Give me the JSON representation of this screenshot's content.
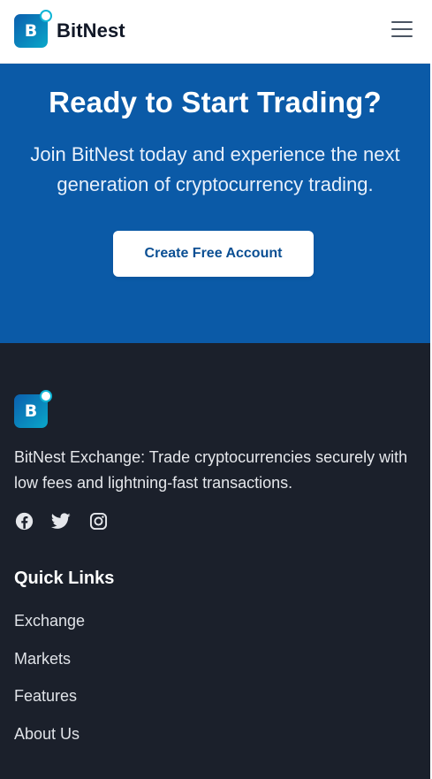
{
  "header": {
    "brand_name": "BitNest",
    "logo_letter": "B",
    "menu_icon": "hamburger-menu-icon"
  },
  "hero": {
    "title": "Ready to Start Trading?",
    "subtitle": "Join BitNest today and experience the next generation of cryptocurrency trading.",
    "cta_label": "Create Free Account"
  },
  "footer": {
    "logo_letter": "B",
    "description": "BitNest Exchange: Trade cryptocurrencies securely with low fees and lightning-fast transactions.",
    "socials": [
      "facebook-icon",
      "twitter-icon",
      "instagram-icon"
    ],
    "quick_links_title": "Quick Links",
    "quick_links": [
      "Exchange",
      "Markets",
      "Features",
      "About Us"
    ]
  },
  "colors": {
    "primary_blue": "#0b5aa7",
    "footer_bg": "#1b202b",
    "logo_gradient_start": "#0b5fae",
    "logo_gradient_end": "#0aa7c9",
    "cta_text": "#0b4f93"
  }
}
